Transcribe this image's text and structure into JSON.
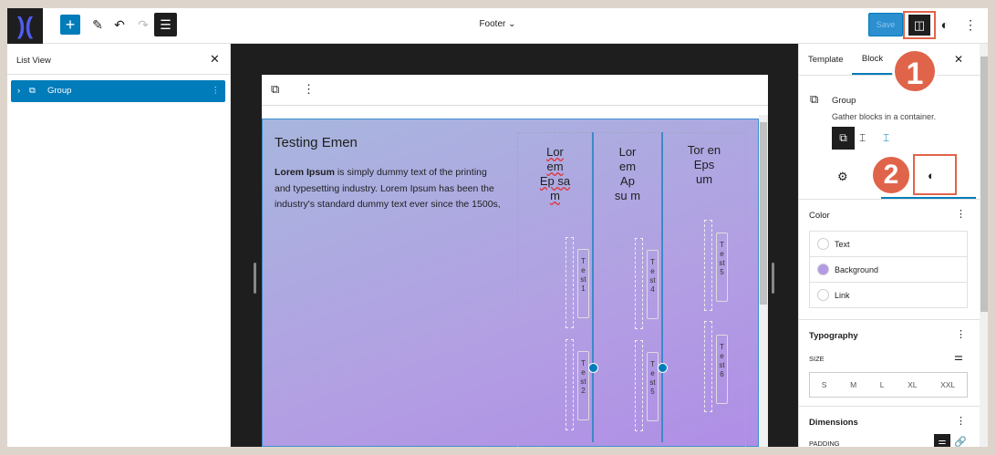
{
  "topbar": {
    "doc_title": "Footer",
    "save": "Save"
  },
  "list_view": {
    "title": "List View",
    "item": "Group"
  },
  "canvas": {
    "heading": "Testing Emen",
    "para_bold": "Lorem Ipsum",
    "para": " is simply dummy text of the printing and typesetting industry. Lorem Ipsum has been the industry's standard dummy text ever since the 1500s,",
    "columns": [
      {
        "title": "Lor em Ep sa m",
        "tests": [
          "Test1",
          "Test2"
        ]
      },
      {
        "title": "Lor em Ap su m",
        "tests": [
          "Test4",
          "Test5"
        ]
      },
      {
        "title": "Tor en Eps um",
        "tests": [
          "Test5",
          "Test6"
        ]
      }
    ]
  },
  "sidebar": {
    "tabs": [
      "Template",
      "Block"
    ],
    "block_name": "Group",
    "block_desc": "Gather blocks in a container.",
    "color_title": "Color",
    "colors": [
      "Text",
      "Background",
      "Link"
    ],
    "typography_title": "Typography",
    "size_label": "SIZE",
    "sizes": [
      "S",
      "M",
      "L",
      "XL",
      "XXL"
    ],
    "dimensions_title": "Dimensions",
    "padding_label": "PADDING"
  },
  "annotations": {
    "one": "1",
    "two": "2"
  },
  "colors": {
    "accent": "#007cba",
    "annotation": "#e0644a",
    "background_swatch": "#b39ae6"
  }
}
